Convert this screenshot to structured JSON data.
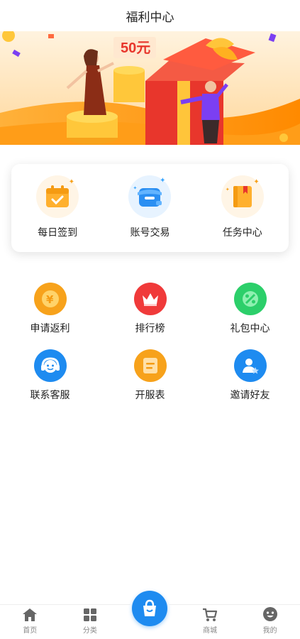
{
  "header": {
    "title": "福利中心"
  },
  "banner": {
    "price_text": "50元"
  },
  "card": {
    "items": [
      {
        "label": "每日签到",
        "icon": "calendar-check-icon"
      },
      {
        "label": "账号交易",
        "icon": "shop-store-icon"
      },
      {
        "label": "任务中心",
        "icon": "task-book-icon"
      }
    ]
  },
  "grid": {
    "items": [
      {
        "label": "申请返利",
        "icon": "yen-coin-icon",
        "color": "#f7a21b"
      },
      {
        "label": "排行榜",
        "icon": "crown-icon",
        "color": "#f03a3a"
      },
      {
        "label": "礼包中心",
        "icon": "gift-percent-icon",
        "color": "#2ccf6a"
      },
      {
        "label": "联系客服",
        "icon": "headset-icon",
        "color": "#1e8bf0"
      },
      {
        "label": "开服表",
        "icon": "list-sheet-icon",
        "color": "#f7a21b"
      },
      {
        "label": "邀请好友",
        "icon": "invite-user-icon",
        "color": "#1e8bf0"
      }
    ]
  },
  "tabbar": {
    "items": [
      {
        "label": "首页",
        "icon": "home-icon"
      },
      {
        "label": "分类",
        "icon": "category-grid-icon"
      },
      {
        "label": "",
        "icon": "shopping-bag-icon"
      },
      {
        "label": "商城",
        "icon": "cart-icon"
      },
      {
        "label": "我的",
        "icon": "smiley-profile-icon"
      }
    ]
  },
  "colors": {
    "accent": "#1e8bf0",
    "orange": "#f7a21b",
    "red": "#f03a3a",
    "green": "#2ccf6a"
  }
}
